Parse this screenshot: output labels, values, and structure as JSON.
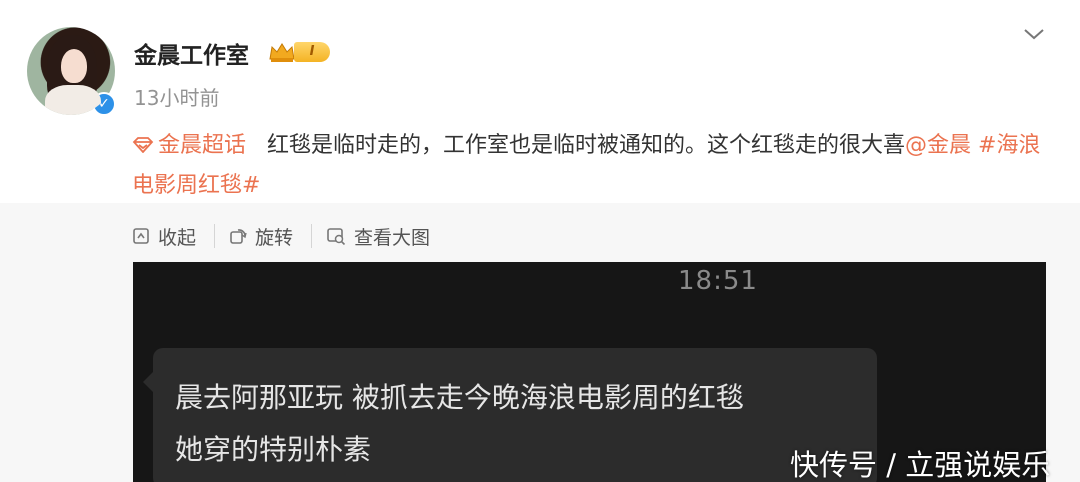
{
  "post": {
    "author": "金晨工作室",
    "level": "I",
    "time": "13小时前",
    "topic": "金晨超话",
    "text_main": "红毯是临时走的，工作室也是临时被通知的。这个红毯走的很大喜",
    "mention": "@金晨",
    "hashtag": "#海浪电影周红毯#"
  },
  "toolbar": {
    "collapse_label": "收起",
    "rotate_label": "旋转",
    "view_large_label": "查看大图"
  },
  "chat_image": {
    "time": "18:51",
    "line1": "晨去阿那亚玩  被抓去走今晚海浪电影周的红毯",
    "line2": "她穿的特别朴素"
  },
  "watermark": "快传号 / 立强说娱乐",
  "icons": {
    "verified": "verified-badge-icon",
    "crown": "crown-icon",
    "chevron": "chevron-down-icon",
    "topic": "diamond-topic-icon"
  },
  "colors": {
    "accent": "#eb7350",
    "verified": "#2d91e8",
    "chat_bg": "#161616"
  }
}
